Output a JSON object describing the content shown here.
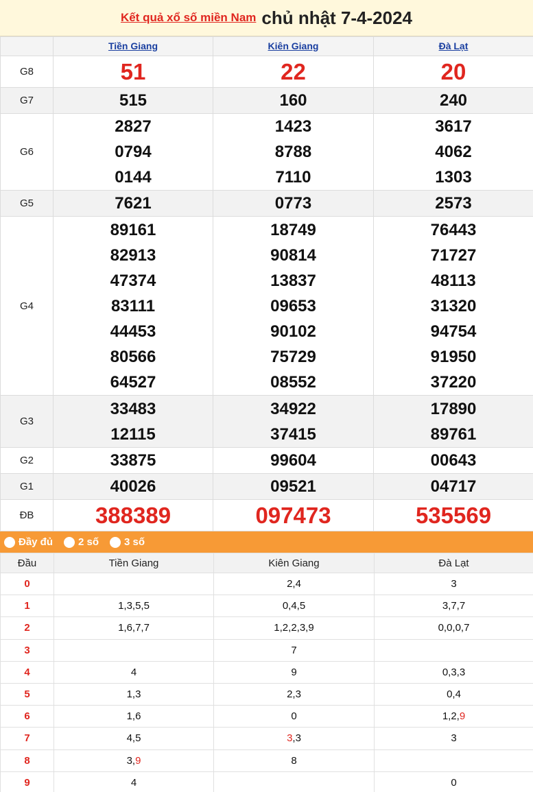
{
  "header": {
    "link_text": "Kết quả xổ số miền Nam",
    "title": "chủ nhật 7-4-2024"
  },
  "provinces": [
    "Tiền Giang",
    "Kiên Giang",
    "Đà Lạt"
  ],
  "prizes": {
    "G8": [
      "51",
      "22",
      "20"
    ],
    "G7": [
      "515",
      "160",
      "240"
    ],
    "G6": [
      [
        "2827",
        "0794",
        "0144"
      ],
      [
        "1423",
        "8788",
        "7110"
      ],
      [
        "3617",
        "4062",
        "1303"
      ]
    ],
    "G5": [
      "7621",
      "0773",
      "2573"
    ],
    "G4": [
      [
        "89161",
        "82913",
        "47374",
        "83111",
        "44453",
        "80566",
        "64527"
      ],
      [
        "18749",
        "90814",
        "13837",
        "09653",
        "90102",
        "75729",
        "08552"
      ],
      [
        "76443",
        "71727",
        "48113",
        "31320",
        "94754",
        "91950",
        "37220"
      ]
    ],
    "G3": [
      [
        "33483",
        "12115"
      ],
      [
        "34922",
        "37415"
      ],
      [
        "17890",
        "89761"
      ]
    ],
    "G2": [
      "33875",
      "99604",
      "00643"
    ],
    "G1": [
      "40026",
      "09521",
      "04717"
    ],
    "DB": [
      "388389",
      "097473",
      "535569"
    ]
  },
  "labels": {
    "g8": "G8",
    "g7": "G7",
    "g6": "G6",
    "g5": "G5",
    "g4": "G4",
    "g3": "G3",
    "g2": "G2",
    "g1": "G1",
    "db": "ĐB"
  },
  "tabs": [
    "Đầy đủ",
    "2 số",
    "3 số"
  ],
  "dau_table": {
    "head": "Đầu",
    "rows": [
      {
        "d": "0",
        "tg": "",
        "kg": "2,4",
        "dl": "3"
      },
      {
        "d": "1",
        "tg": "1,3,5,5",
        "kg": "0,4,5",
        "dl": "3,7,7"
      },
      {
        "d": "2",
        "tg": "1,6,7,7",
        "kg": "1,2,2,3,9",
        "dl": "0,0,0,7"
      },
      {
        "d": "3",
        "tg": "",
        "kg": "7",
        "dl": ""
      },
      {
        "d": "4",
        "tg": "4",
        "kg": "9",
        "dl": "0,3,3"
      },
      {
        "d": "5",
        "tg": "1,3",
        "kg": "2,3",
        "dl": "0,4"
      },
      {
        "d": "6",
        "tg": "1,6",
        "kg": "0",
        "dl_a": "1,2,",
        "dl_b": "9"
      },
      {
        "d": "7",
        "tg": "4,5",
        "kg_a": "3",
        "kg_b": ",3",
        "dl": "3"
      },
      {
        "d": "8",
        "tg_a": "3,",
        "tg_b": "9",
        "kg": "8",
        "dl": ""
      },
      {
        "d": "9",
        "tg": "4",
        "kg": "",
        "dl": "0"
      }
    ]
  },
  "colors": {
    "accent_red": "#e0261f",
    "tab_orange": "#f79a36",
    "header_bg": "#fff8dc",
    "link_blue": "#1a3fa0"
  }
}
